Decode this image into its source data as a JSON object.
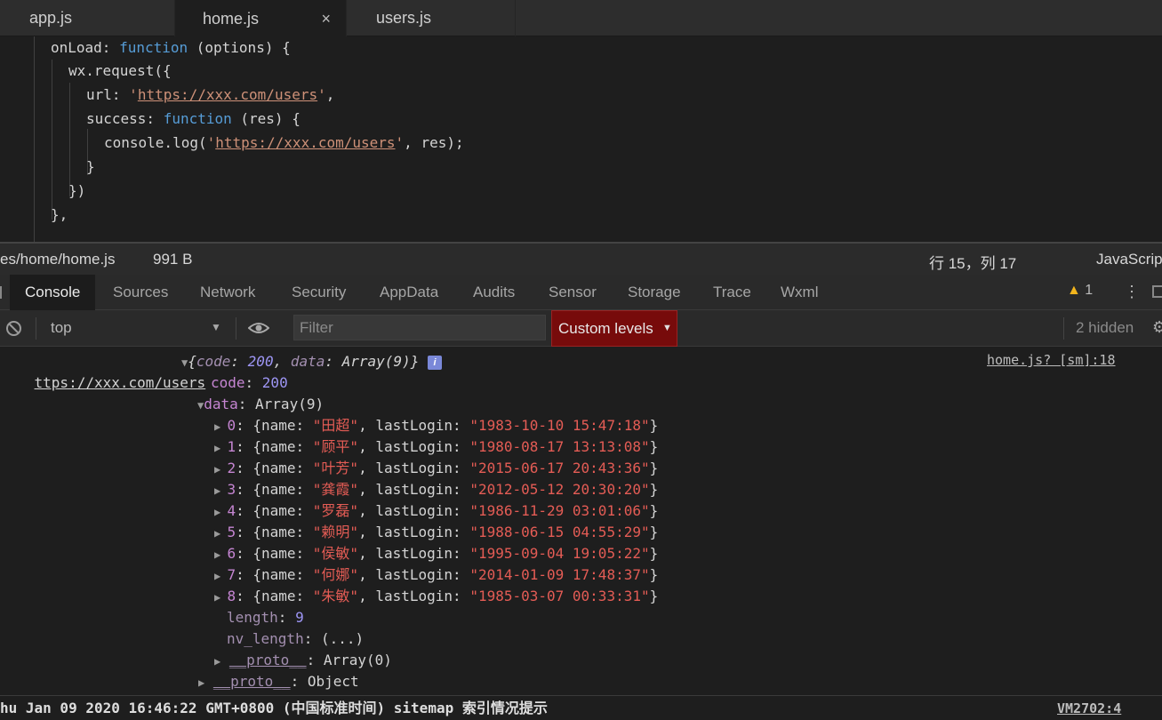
{
  "tabs": [
    {
      "label": "app.js"
    },
    {
      "label": "home.js",
      "close": "×"
    },
    {
      "label": "users.js"
    }
  ],
  "code": {
    "l1": {
      "a": "onLoad: ",
      "kw": "function",
      "b": " (options) {"
    },
    "l2": {
      "a": "wx.request({"
    },
    "l3": {
      "a": "url: ",
      "q1": "'",
      "url": "https://xxx.com/users",
      "q2": "'",
      "b": ","
    },
    "l4": {
      "a": "success: ",
      "kw": "function",
      "b": " (res) {"
    },
    "l5": {
      "a": "console.log(",
      "q1": "'",
      "url": "https://xxx.com/users",
      "q2": "'",
      "b": ", res);"
    },
    "l6": {
      "a": "}"
    },
    "l7": {
      "a": "})"
    },
    "l8": {
      "a": "},"
    }
  },
  "status": {
    "path": "es/home/home.js",
    "size": "991 B",
    "position": "行 15，列 17",
    "language": "JavaScrip"
  },
  "devtools": {
    "tabs": [
      "Console",
      "Sources",
      "Network",
      "Security",
      "AppData",
      "Audits",
      "Sensor",
      "Storage",
      "Trace",
      "Wxml"
    ],
    "warnings": "1"
  },
  "toolbar": {
    "context": "top",
    "filter_placeholder": "Filter",
    "levels": "Custom levels",
    "hidden": "2 hidden"
  },
  "console": {
    "source_text": "ttps://xxx.com/users",
    "summary": {
      "code_key": "code",
      "code_val": "200",
      "data_key": "data",
      "data_val": "Array(9)"
    },
    "source_link": "home.js? [sm]:18",
    "code_row": {
      "key": "code",
      "val": "200"
    },
    "data_row": {
      "key": "data",
      "val": "Array(9)"
    },
    "entries": [
      {
        "index": "0",
        "name": "\"田超\"",
        "lastLogin": "\"1983-10-10 15:47:18\""
      },
      {
        "index": "1",
        "name": "\"顾平\"",
        "lastLogin": "\"1980-08-17 13:13:08\""
      },
      {
        "index": "2",
        "name": "\"叶芳\"",
        "lastLogin": "\"2015-06-17 20:43:36\""
      },
      {
        "index": "3",
        "name": "\"龚霞\"",
        "lastLogin": "\"2012-05-12 20:30:20\""
      },
      {
        "index": "4",
        "name": "\"罗磊\"",
        "lastLogin": "\"1986-11-29 03:01:06\""
      },
      {
        "index": "5",
        "name": "\"赖明\"",
        "lastLogin": "\"1988-06-15 04:55:29\""
      },
      {
        "index": "6",
        "name": "\"侯敏\"",
        "lastLogin": "\"1995-09-04 19:05:22\""
      },
      {
        "index": "7",
        "name": "\"何娜\"",
        "lastLogin": "\"2014-01-09 17:48:37\""
      },
      {
        "index": "8",
        "name": "\"朱敏\"",
        "lastLogin": "\"1985-03-07 00:33:31\""
      }
    ],
    "length_row": {
      "key": "length",
      "val": "9"
    },
    "nvlength_row": {
      "key": "nv_length",
      "val": "(...)"
    },
    "proto_array": {
      "key": "__proto__",
      "val": "Array(0)"
    },
    "proto_object": {
      "key": "__proto__",
      "val": "Object"
    }
  },
  "footer": {
    "text": "hu Jan 09 2020 16:46:22 GMT+0800 (中国标准时间) sitemap 索引情况提示",
    "link": "VM2702:4"
  }
}
